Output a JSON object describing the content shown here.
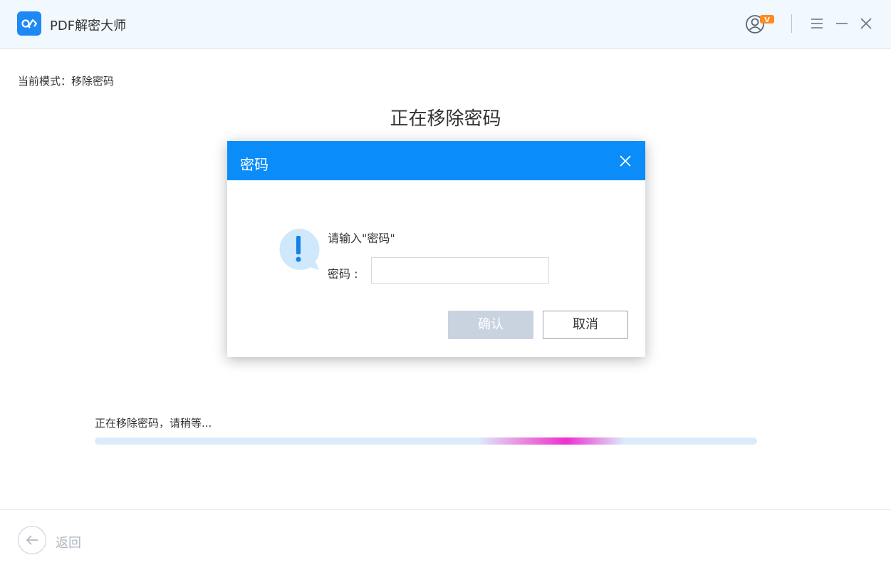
{
  "app": {
    "title": "PDF解密大师",
    "user_badge": "V"
  },
  "page": {
    "mode_label": "当前模式：移除密码",
    "heading": "正在移除密码",
    "progress_label": "正在移除密码，请稍等...",
    "back_label": "返回"
  },
  "progress": {
    "glow_start_fraction": 0.58,
    "glow_width_fraction": 0.22
  },
  "dialog": {
    "title": "密码",
    "prompt": "请输入\"密码\"",
    "password_label": "密码 :",
    "password_value": "",
    "confirm_label": "确认",
    "cancel_label": "取消"
  },
  "icons": {
    "logo": "link-magnifier-icon",
    "user": "user-avatar-icon",
    "menu": "menu-icon",
    "minimize": "minimize-icon",
    "close": "close-icon",
    "back": "arrow-left-icon",
    "alert": "exclamation-bubble-icon"
  },
  "colors": {
    "accent": "#0a8cf9",
    "titlebar_bg": "#f1f8fe",
    "confirm_disabled": "#c9d3e0",
    "progress_track": "#dcebfb",
    "progress_glow": "#ee2fcf",
    "badge": "#ff8a1f"
  }
}
